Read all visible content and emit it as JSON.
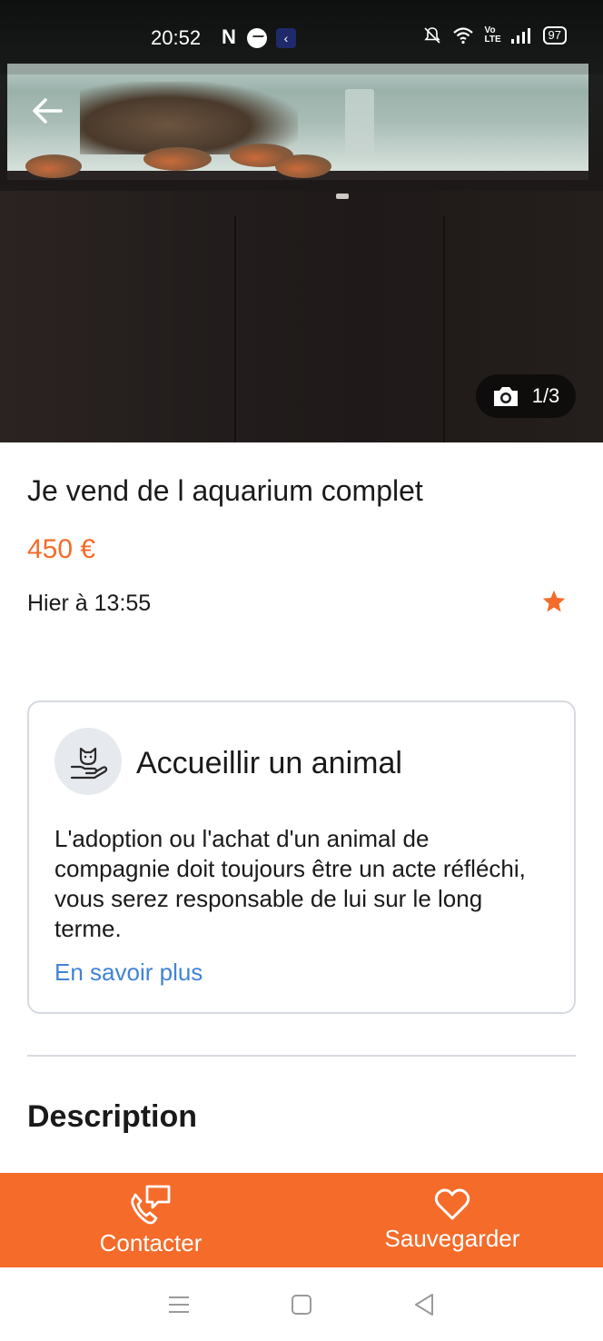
{
  "status_bar": {
    "time": "20:52",
    "app_icons": [
      "netflix-icon",
      "messenger-icon",
      "app-icon"
    ],
    "right_icons": [
      "mute-bell-icon",
      "wifi-icon",
      "volte-icon",
      "signal-icon",
      "battery-icon"
    ],
    "volte": "Vo LTE",
    "battery": "97"
  },
  "photo": {
    "counter": "1/3",
    "counter_icon": "camera-icon"
  },
  "listing": {
    "title": "Je vend de l aquarium complet",
    "price": "450 €",
    "date": "Hier à 13:55"
  },
  "info_card": {
    "title": "Accueillir un animal",
    "text": "L'adoption ou l'achat d'un animal de compagnie doit toujours être un acte réfléchi, vous serez responsable de lui sur le long terme.",
    "link": "En savoir plus"
  },
  "description": {
    "title": "Description"
  },
  "actions": {
    "contact_label": "Contacter",
    "save_label": "Sauvegarder"
  },
  "colors": {
    "accent": "#f56b2a",
    "link": "#4183d7",
    "border": "#d6dae0"
  }
}
